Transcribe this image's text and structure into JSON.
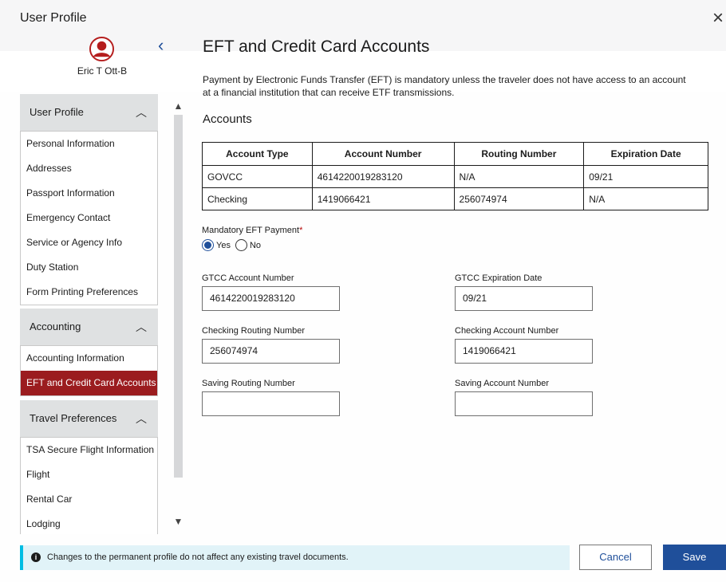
{
  "modal": {
    "title": "User Profile",
    "user_name": "Eric T Ott-B",
    "colors": {
      "primary": "#1f4f9a",
      "active": "#9b1c1f",
      "notice_bg": "#e1f3f8",
      "notice_accent": "#00bde3"
    }
  },
  "sidebar": {
    "sections": [
      {
        "header": "User Profile",
        "items": [
          "Personal Information",
          "Addresses",
          "Passport Information",
          "Emergency Contact",
          "Service or Agency Info",
          "Duty Station",
          "Form Printing Preferences"
        ]
      },
      {
        "header": "Accounting",
        "items": [
          "Accounting Information",
          "EFT and Credit Card Accounts"
        ]
      },
      {
        "header": "Travel Preferences",
        "items": [
          "TSA Secure Flight Information",
          "Flight",
          "Rental Car",
          "Lodging"
        ]
      }
    ]
  },
  "main": {
    "title": "EFT and Credit Card Accounts",
    "description": "Payment by Electronic Funds Transfer (EFT) is mandatory unless the traveler does not have access to an account at a financial institution that can receive ETF transmissions.",
    "accounts_heading": "Accounts",
    "table": {
      "headers": [
        "Account Type",
        "Account Number",
        "Routing Number",
        "Expiration Date"
      ],
      "rows": [
        [
          "GOVCC",
          "4614220019283120",
          "N/A",
          "09/21"
        ],
        [
          "Checking",
          "1419066421",
          "256074974",
          "N/A"
        ]
      ]
    },
    "mandatory_eft": {
      "label": "Mandatory EFT Payment",
      "required_mark": "*",
      "yes": "Yes",
      "no": "No",
      "selected": "Yes"
    },
    "fields": {
      "gtcc_account_label": "GTCC Account Number",
      "gtcc_account_value": "4614220019283120",
      "gtcc_exp_label": "GTCC Expiration Date",
      "gtcc_exp_value": "09/21",
      "checking_routing_label": "Checking Routing Number",
      "checking_routing_value": "256074974",
      "checking_account_label": "Checking Account Number",
      "checking_account_value": "1419066421",
      "saving_routing_label": "Saving Routing Number",
      "saving_routing_value": "",
      "saving_account_label": "Saving Account Number",
      "saving_account_value": ""
    }
  },
  "footer": {
    "notice": "Changes to the permanent profile do not affect any existing travel documents.",
    "cancel": "Cancel",
    "save": "Save"
  }
}
